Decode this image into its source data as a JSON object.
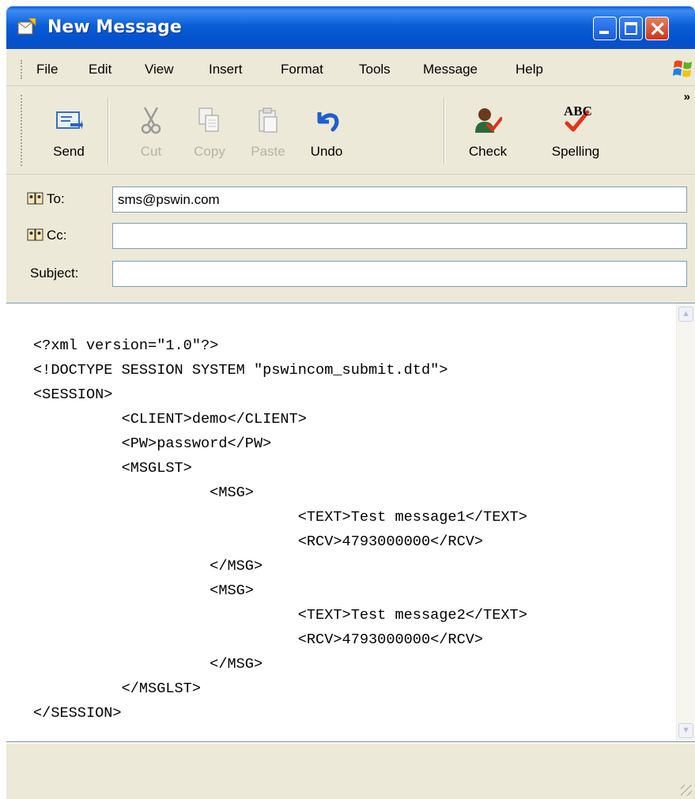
{
  "window": {
    "title": "New Message"
  },
  "menu": [
    "File",
    "Edit",
    "View",
    "Insert",
    "Format",
    "Tools",
    "Message",
    "Help"
  ],
  "toolbar": {
    "send": "Send",
    "cut": "Cut",
    "copy": "Copy",
    "paste": "Paste",
    "undo": "Undo",
    "check": "Check",
    "spelling": "Spelling",
    "spelling_icon_text": "ABC"
  },
  "header": {
    "to_label": "To:",
    "to_value": "sms@pswin.com",
    "cc_label": "Cc:",
    "cc_value": "",
    "subject_label": "Subject:",
    "subject_value": ""
  },
  "body": {
    "lines": [
      "<?xml version=\"1.0\"?>",
      "<!DOCTYPE SESSION SYSTEM \"pswincom_submit.dtd\">",
      "<SESSION>",
      "\t<CLIENT>demo</CLIENT>",
      "\t<PW>password</PW>",
      "\t<MSGLST>",
      "\t\t<MSG>",
      "\t\t\t<TEXT>Test message1</TEXT>",
      "\t\t\t<RCV>4793000000</RCV>",
      "\t\t</MSG>",
      "\t\t<MSG>",
      "\t\t\t<TEXT>Test message2</TEXT>",
      "\t\t\t<RCV>4793000000</RCV>",
      "\t\t</MSG>",
      "\t</MSGLST>",
      "</SESSION>"
    ]
  },
  "colors": {
    "titlebar": "#0a5ed6",
    "chrome": "#ece9d8",
    "close_button": "#c9361c"
  },
  "icons": [
    "new-message-icon",
    "minimize-icon",
    "maximize-icon",
    "close-icon",
    "windows-logo-icon",
    "send-icon",
    "cut-icon",
    "copy-icon",
    "paste-icon",
    "undo-icon",
    "check-names-icon",
    "spelling-icon",
    "address-book-icon"
  ]
}
